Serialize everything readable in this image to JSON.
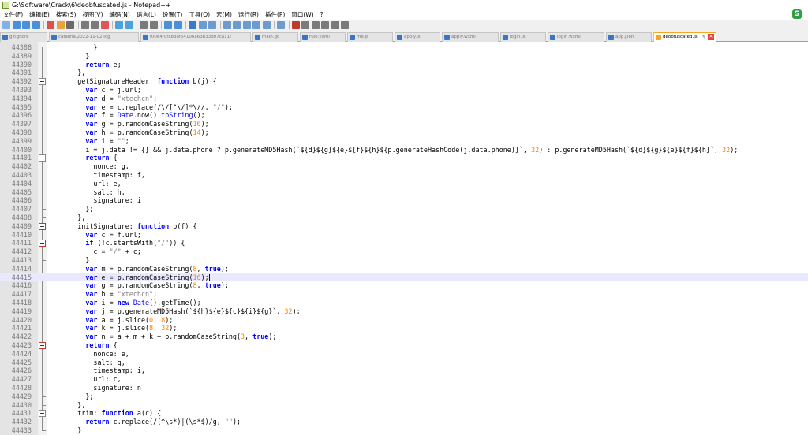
{
  "window": {
    "title": "G:\\Software\\Crack\\6\\deobfuscated.js - Notepad++",
    "ime_label": "S"
  },
  "menu": [
    "文件(F)",
    "编辑(E)",
    "搜索(S)",
    "视图(V)",
    "编码(N)",
    "语言(L)",
    "设置(T)",
    "工具(O)",
    "宏(M)",
    "运行(R)",
    "插件(P)",
    "窗口(W)",
    "?"
  ],
  "tabs": [
    {
      "label": "gitignore",
      "active": false
    },
    {
      "label": "catalina.2022-11-02.log",
      "active": false
    },
    {
      "label": "f00e4f0fa83af54106a63b33d07ca11f",
      "active": false
    },
    {
      "label": "main.go",
      "active": false
    },
    {
      "label": "rule.yaml",
      "active": false
    },
    {
      "label": "me.js",
      "active": false
    },
    {
      "label": "apply.js",
      "active": false
    },
    {
      "label": "apply.wxml",
      "active": false
    },
    {
      "label": "login.js",
      "active": false
    },
    {
      "label": "login.wxml",
      "active": false
    },
    {
      "label": "app.json",
      "active": false
    },
    {
      "label": "deobfuscated.js",
      "active": true
    }
  ],
  "editor": {
    "current_line": 44415,
    "lines": [
      {
        "n": "44388",
        "html": "          }"
      },
      {
        "n": "44389",
        "html": "        }"
      },
      {
        "n": "44390",
        "html": "        <span class=\"kw\">return</span> e;"
      },
      {
        "n": "44391",
        "html": "      },"
      },
      {
        "n": "44392",
        "html": "      getSignatureHeader: <span class=\"kw\">function</span> b(j) {"
      },
      {
        "n": "44393",
        "html": "        <span class=\"kw\">var</span> c = j.url;"
      },
      {
        "n": "44394",
        "html": "        <span class=\"kw\">var</span> d = <span class=\"str\">\"xtechcn\"</span>;"
      },
      {
        "n": "44395",
        "html": "        <span class=\"kw\">var</span> e = c.replace(/\\/[^\\/]*\\//, <span class=\"str\">\"/\"</span>);"
      },
      {
        "n": "44396",
        "html": "        <span class=\"kw\">var</span> f = <span class=\"fn\">Date</span>.now().<span class=\"fn\">toString</span>();"
      },
      {
        "n": "44397",
        "html": "        <span class=\"kw\">var</span> g = p.randomCaseString(<span class=\"num\">16</span>);"
      },
      {
        "n": "44398",
        "html": "        <span class=\"kw\">var</span> h = p.randomCaseString(<span class=\"num\">14</span>);"
      },
      {
        "n": "44399",
        "html": "        <span class=\"kw\">var</span> i = <span class=\"str\">\"\"</span>;"
      },
      {
        "n": "44400",
        "html": "        i = j.data != {} &amp;&amp; j.data.phone ? p.generateMD5Hash(`${d}${g}${e}${f}${h}${p.generateHashCode(j.data.phone)}`, <span class=\"num\">32</span>) : p.generateMD5Hash(`${d}${g}${e}${f}${h}`, <span class=\"num\">32</span>);"
      },
      {
        "n": "44401",
        "html": "        <span class=\"kw\">return</span> {"
      },
      {
        "n": "44402",
        "html": "          nonce: g,"
      },
      {
        "n": "44403",
        "html": "          timestamp: f,"
      },
      {
        "n": "44404",
        "html": "          url: e,"
      },
      {
        "n": "44405",
        "html": "          salt: h,"
      },
      {
        "n": "44406",
        "html": "          signature: i"
      },
      {
        "n": "44407",
        "html": "        };"
      },
      {
        "n": "44408",
        "html": "      },"
      },
      {
        "n": "44409",
        "html": "      initSignature: <span class=\"kw\">function</span> b(f) {"
      },
      {
        "n": "44410",
        "html": "        <span class=\"kw\">var</span> c = f.url;"
      },
      {
        "n": "44411",
        "html": "        <span class=\"kw\">if</span> (!c.startsWith(<span class=\"str\">\"/\"</span>)) {"
      },
      {
        "n": "44412",
        "html": "          c = <span class=\"str\">\"/\"</span> + c;"
      },
      {
        "n": "44413",
        "html": "        }"
      },
      {
        "n": "44414",
        "html": "        <span class=\"kw\">var</span> m = p.randomCaseString(<span class=\"num\">8</span>, <span class=\"kw\">true</span>);"
      },
      {
        "n": "44415",
        "html": "        <span class=\"kw\">var</span> e = p.randomCaseString(<span class=\"num\">16</span>);<span class=\"cursor\"></span>"
      },
      {
        "n": "44416",
        "html": "        <span class=\"kw\">var</span> g = p.randomCaseString(<span class=\"num\">8</span>, <span class=\"kw\">true</span>);"
      },
      {
        "n": "44417",
        "html": "        <span class=\"kw\">var</span> h = <span class=\"str\">\"xtechcn\"</span>;"
      },
      {
        "n": "44418",
        "html": "        <span class=\"kw\">var</span> i = <span class=\"kw\">new</span> <span class=\"fn\">Date</span>().getTime();"
      },
      {
        "n": "44419",
        "html": "        <span class=\"kw\">var</span> j = p.generateMD5Hash(`${h}${e}${c}${i}${g}`, <span class=\"num\">32</span>);"
      },
      {
        "n": "44420",
        "html": "        <span class=\"kw\">var</span> a = j.slice(<span class=\"num\">0</span>, <span class=\"num\">8</span>);"
      },
      {
        "n": "44421",
        "html": "        <span class=\"kw\">var</span> k = j.slice(<span class=\"num\">8</span>, <span class=\"num\">32</span>);"
      },
      {
        "n": "44422",
        "html": "        <span class=\"kw\">var</span> n = a + m + k + p.randomCaseString(<span class=\"num\">3</span>, <span class=\"kw\">true</span>);"
      },
      {
        "n": "44423",
        "html": "        <span class=\"kw\">return</span> {"
      },
      {
        "n": "44424",
        "html": "          nonce: e,"
      },
      {
        "n": "44425",
        "html": "          salt: g,"
      },
      {
        "n": "44426",
        "html": "          timestamp: i,"
      },
      {
        "n": "44427",
        "html": "          url: c,"
      },
      {
        "n": "44428",
        "html": "          signature: n"
      },
      {
        "n": "44429",
        "html": "        };"
      },
      {
        "n": "44430",
        "html": "      },"
      },
      {
        "n": "44431",
        "html": "      trim: <span class=\"kw\">function</span> a(c) {"
      },
      {
        "n": "44432",
        "html": "        <span class=\"kw\">return</span> c.replace(/(^\\s*)|(\\s*$)/g, <span class=\"str\">\"\"</span>);"
      },
      {
        "n": "44433",
        "html": "      }"
      }
    ]
  },
  "colors": {
    "keyword": "#0000ff",
    "string": "#808080",
    "number": "#ff8000",
    "active_tab_accent": "#f5a623",
    "current_line_bg": "#e8e8ff"
  }
}
